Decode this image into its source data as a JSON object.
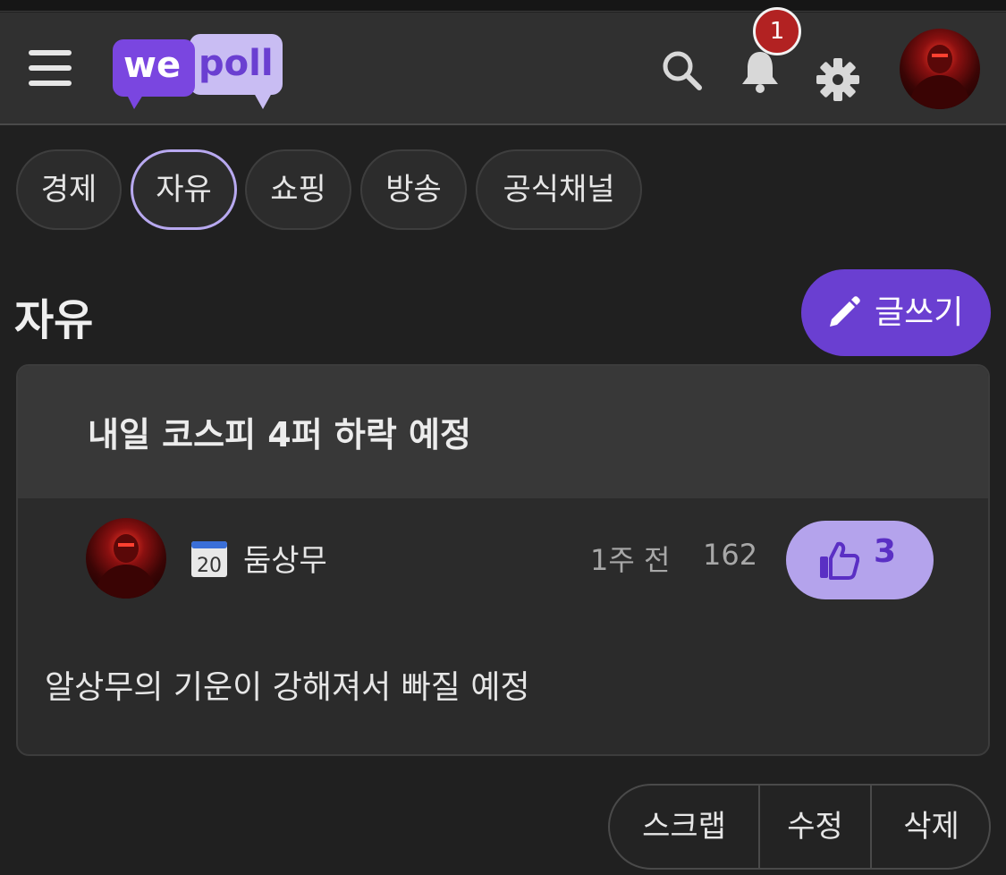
{
  "header": {
    "logo_left": "we",
    "logo_right": "poll",
    "notification_count": "1",
    "icons": [
      "hamburger-menu-icon",
      "search-icon",
      "bell-icon",
      "gear-icon",
      "avatar"
    ]
  },
  "tabs": [
    {
      "label": "경제",
      "active": false
    },
    {
      "label": "자유",
      "active": true
    },
    {
      "label": "쇼핑",
      "active": false
    },
    {
      "label": "방송",
      "active": false
    },
    {
      "label": "공식채널",
      "active": false
    }
  ],
  "page": {
    "title": "자유",
    "write_label": "글쓰기"
  },
  "post": {
    "title": "내일 코스피 4퍼 하락 예정",
    "calendar_day": "20",
    "author": "둠상무",
    "time": "1주 전",
    "views": "162",
    "likes": "3",
    "body": "알상무의 기운이 강해져서 빠질 예정"
  },
  "actions": {
    "scrap": "스크랩",
    "edit": "수정",
    "delete": "삭제"
  },
  "colors": {
    "background": "#202020",
    "header": "#303030",
    "accent": "#6a3fd1",
    "like_bg": "#b4a3ec",
    "badge": "#b22222"
  }
}
